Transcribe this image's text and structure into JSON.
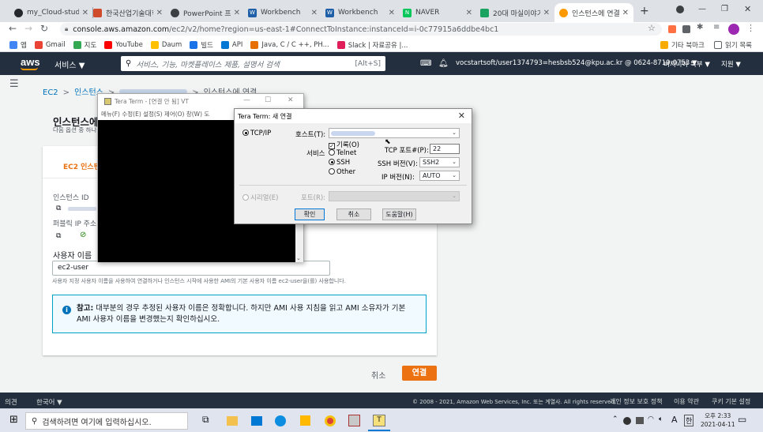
{
  "browser": {
    "tabs": [
      {
        "title": "my_Cloud-studio",
        "icon": "github-icon",
        "color": "#24292e"
      },
      {
        "title": "한국산업기술대학",
        "icon": "university-icon",
        "color": "#d04a2c"
      },
      {
        "title": "PowerPoint 프리",
        "icon": "powerpoint-icon",
        "color": "#3c4043"
      },
      {
        "title": "Workbench",
        "icon": "workbench-icon",
        "color": "#1f5fa8"
      },
      {
        "title": "Workbench",
        "icon": "workbench-icon",
        "color": "#1f5fa8"
      },
      {
        "title": "NAVER",
        "icon": "naver-icon",
        "color": "#03c75a"
      },
      {
        "title": "20대 마실이야기",
        "icon": "chat-icon",
        "color": "#1aa260"
      },
      {
        "title": "인스턴스에 연결",
        "icon": "aws-icon",
        "color": "#ff9900"
      }
    ],
    "url_domain": "console.aws.amazon.com",
    "url_path": "/ec2/v2/home?region=us-east-1#ConnectToInstance:instanceId=i-0c77915a6ddbe4bc1",
    "bookmarks": [
      {
        "label": "앱",
        "color": "#4285f4"
      },
      {
        "label": "Gmail",
        "color": "#ea4335"
      },
      {
        "label": "지도",
        "color": "#34a853"
      },
      {
        "label": "YouTube",
        "color": "#ff0000"
      },
      {
        "label": "Daum",
        "color": "#ffc000"
      },
      {
        "label": "빌드",
        "color": "#1a73e8"
      },
      {
        "label": "API",
        "color": "#0078d4"
      },
      {
        "label": "Java, C / C ++, PH...",
        "color": "#e76f00"
      },
      {
        "label": "Slack | 자료공유 |...",
        "color": "#e01e5a"
      }
    ],
    "bookmarks_other": "기타 북마크",
    "reading_list": "읽기 목록"
  },
  "aws": {
    "logo": "aws",
    "services": "서비스 ▼",
    "search_placeholder": "서비스, 기능, 마켓플레이스 제품, 설명서 검색",
    "search_shortcut": "[Alt+S]",
    "account": "vocstartsoft/user1374793=hesbsb524@kpu.ac.kr @ 0624-8719-0753 ▼",
    "region": "버지니아 북부 ▼",
    "support": "지원 ▼"
  },
  "page": {
    "breadcrumb": [
      "EC2",
      "인스턴스",
      "",
      "인스턴스에 연결"
    ],
    "title": "인스턴스에",
    "subtitle": "다음 옵션 중 하나",
    "tab_label": "EC2 인스턴",
    "instance_id_label": "인스턴스 ID",
    "public_ip_label": "퍼블릭 IP 주소",
    "username_label": "사용자 이름",
    "username_value": "ec2-user",
    "username_help": "사용자 지정 사용자 이름을 사용하여 연결하거나 인스턴스 시작에 사용한 AMI의 기본 사용자 이름 ec2-user을(를) 사용합니다.",
    "note_bold": "참고:",
    "note_text": " 대부분의 경우 추정된 사용자 이름은 정확합니다. 하지만 AMI 사용 지침을 읽고 AMI 소유자가 기본 AMI 사용자 이름을 변경했는지 확인하십시오.",
    "cancel": "취소",
    "connect": "연결"
  },
  "footer": {
    "feedback": "의견",
    "language": "한국어 ▼",
    "copyright": "© 2008 - 2021, Amazon Web Services, Inc. 또는 계열사. All rights reserved.",
    "privacy": "개인 정보 보호 정책",
    "terms": "이용 약관",
    "cookies": "쿠키 기본 설정"
  },
  "vt": {
    "title": "Tera Term - [연결 안 됨] VT",
    "menu": "메뉴(F)  수정(E)  설정(S)  제어(O)  창(W)  도"
  },
  "dialog": {
    "title": "Tera Term: 새 연결",
    "tcpip": "TCP/IP",
    "host_label": "호스트(T):",
    "host_value": "",
    "history": "기록(O)",
    "service_label": "서비스",
    "telnet": "Telnet",
    "ssh": "SSH",
    "other": "Other",
    "tcp_port_label": "TCP 포트#(P):",
    "tcp_port_value": "22",
    "ssh_version_label": "SSH 버전(V):",
    "ssh_version_value": "SSH2",
    "ip_version_label": "IP 버전(N):",
    "ip_version_value": "AUTO",
    "serial": "시리얼(E)",
    "port_label": "포트(R):",
    "ok": "확인",
    "cancel": "취소",
    "help": "도움말(H)"
  },
  "taskbar": {
    "search_placeholder": "검색하려면 여기에 입력하십시오.",
    "ime": "A",
    "hangul": "한",
    "time": "오후 2:33",
    "date": "2021-04-11"
  }
}
